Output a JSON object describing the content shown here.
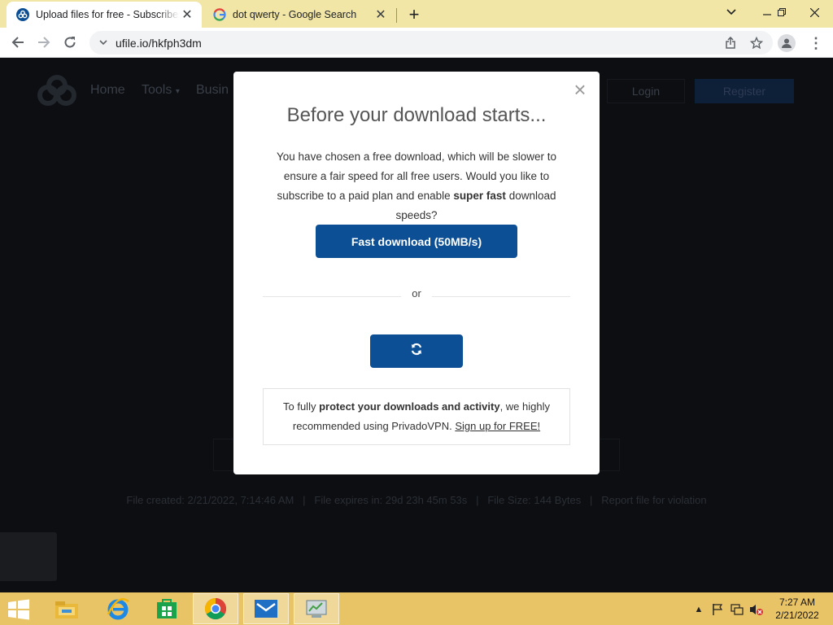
{
  "browser": {
    "tabs": [
      {
        "title": "Upload files for free - Subscribe t",
        "active": true,
        "favicon": "ufile-icon"
      },
      {
        "title": "dot qwerty - Google Search",
        "active": false,
        "favicon": "google-icon"
      }
    ],
    "url": "ufile.io/hkfph3dm"
  },
  "page": {
    "nav": {
      "home": "Home",
      "tools": "Tools",
      "business": "Busin"
    },
    "login": "Login",
    "register": "Register",
    "file_info": "File created: 2/21/2022, 7:14:46 AM   |   File expires in: 29d 23h 45m 53s   |   File Size: 144 Bytes   |   Report file for violation"
  },
  "modal": {
    "title": "Before your download starts...",
    "desc_part1": "You have chosen a free download, which will be slower to ensure a fair speed for all free users. Would you like to subscribe to a paid plan and enable ",
    "desc_bold": "super fast",
    "desc_part2": " download speeds?",
    "fast_button": "Fast download (50MB/s)",
    "or_text": "or",
    "vpn_part1": "To fully ",
    "vpn_bold": "protect your downloads and activity",
    "vpn_part2": ", we highly recommended using PrivadoVPN. ",
    "vpn_link": "Sign up for FREE!"
  },
  "taskbar": {
    "time": "7:27 AM",
    "date": "2/21/2022",
    "apps": [
      "file-explorer-icon",
      "internet-explorer-icon",
      "store-icon",
      "chrome-icon",
      "mail-icon",
      "control-panel-icon"
    ]
  },
  "colors": {
    "brand_blue": "#0d4f94",
    "taskbar": "#e9c466",
    "tabstrip": "#f2e6a6"
  }
}
